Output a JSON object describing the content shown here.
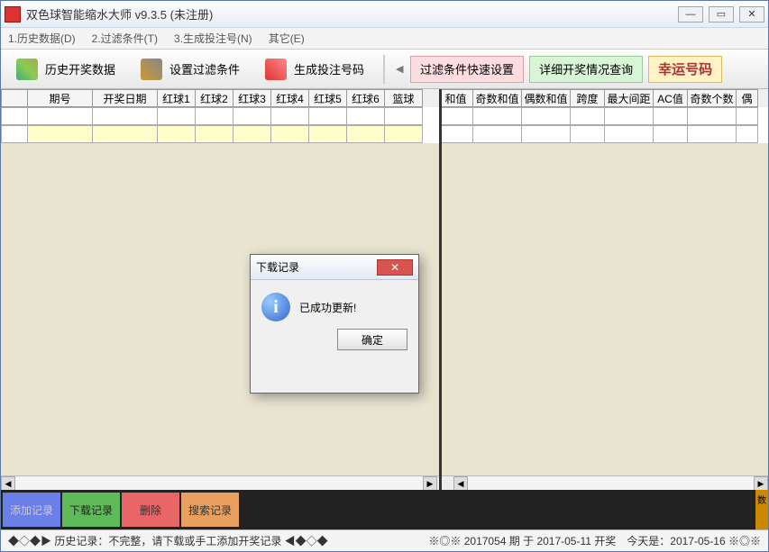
{
  "title": "双色球智能缩水大师 v9.3.5  (未注册)",
  "menu": {
    "m1": "1.历史数据(D)",
    "m2": "2.过滤条件(T)",
    "m3": "3.生成投注号(N)",
    "m4": "其它(E)"
  },
  "toolbar": {
    "history": "历史开奖数据",
    "filter": "设置过滤条件",
    "generate": "生成投注号码",
    "quick_filter": "过滤条件快速设置",
    "detail_query": "详细开奖情况查询",
    "lucky": "幸运号码"
  },
  "columns_left": [
    "",
    "期号",
    "开奖日期",
    "红球1",
    "红球2",
    "红球3",
    "红球4",
    "红球5",
    "红球6",
    "篮球"
  ],
  "columns_right": [
    "和值",
    "奇数和值",
    "偶数和值",
    "跨度",
    "最大间距",
    "AC值",
    "奇数个数",
    "偶"
  ],
  "bottom_buttons": {
    "add": "添加记录",
    "download": "下载记录",
    "delete": "删除",
    "search": "搜索记录"
  },
  "right_indicator": "数",
  "status_left": "◆◇◆▶ 历史记录：不完整，请下载或手工添加开奖记录 ◀◆◇◆",
  "status_right": "※◎※ 2017054 期 于 2017-05-11 开奖　今天是：2017-05-16 ※◎※",
  "dialog": {
    "title": "下载记录",
    "message": "已成功更新!",
    "ok": "确定"
  }
}
